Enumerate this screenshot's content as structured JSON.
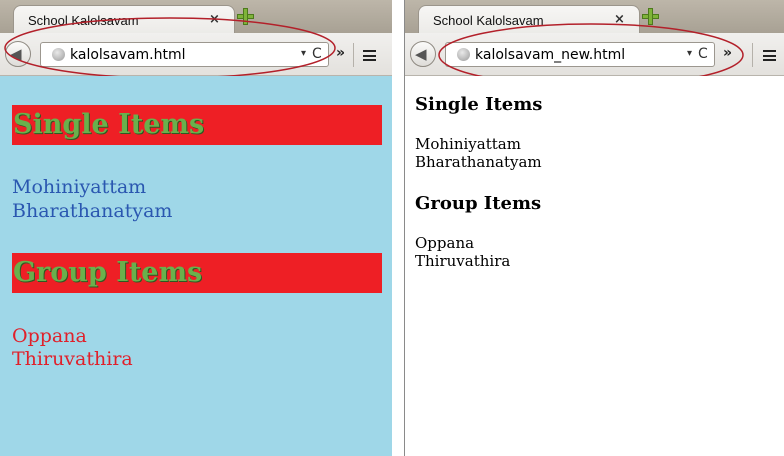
{
  "colors": {
    "styled_background": "#9fd7e8",
    "heading_background": "#ee1f25",
    "heading_text": "#6ab04c",
    "single_items_text": "#2a57b0",
    "group_items_text": "#e0202a",
    "annotation_ellipse": "#b3202a"
  },
  "windows": [
    {
      "tab": {
        "title": "School Kalolsavam",
        "close_icon": "×"
      },
      "urlbar": {
        "value": "kalolsavam.html",
        "dropdown_icon": "▾",
        "reload_icon": "C"
      },
      "toolbar": {
        "overflow_icon": "»",
        "menu_icon": "hamburger-menu"
      },
      "page": {
        "single_heading": "Single Items",
        "single_items": [
          "Mohiniyattam",
          "Bharathanatyam"
        ],
        "group_heading": "Group Items",
        "group_items": [
          "Oppana",
          "Thiruvathira"
        ]
      }
    },
    {
      "tab": {
        "title": "School Kalolsavam",
        "close_icon": "×"
      },
      "urlbar": {
        "value": "kalolsavam_new.html",
        "dropdown_icon": "▾",
        "reload_icon": "C"
      },
      "toolbar": {
        "overflow_icon": "»",
        "menu_icon": "hamburger-menu"
      },
      "page": {
        "single_heading": "Single Items",
        "single_items": [
          "Mohiniyattam",
          "Bharathanatyam"
        ],
        "group_heading": "Group Items",
        "group_items": [
          "Oppana",
          "Thiruvathira"
        ]
      }
    }
  ]
}
